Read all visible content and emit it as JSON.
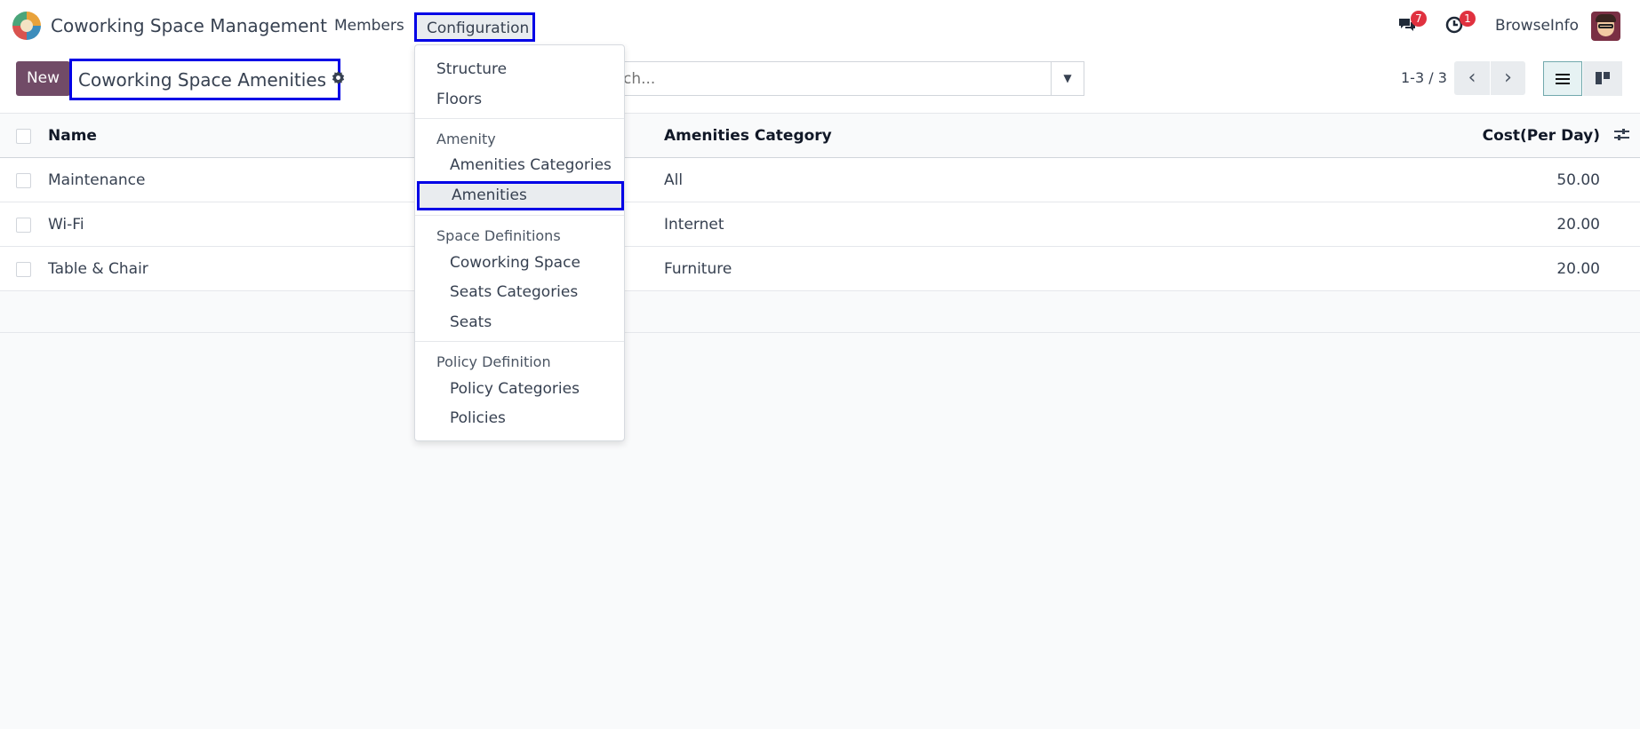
{
  "navbar": {
    "app_title": "Coworking Space Management",
    "menu": {
      "members": "Members",
      "configuration": "Configuration"
    },
    "messages_count": "7",
    "activities_count": "1",
    "company": "BrowseInfo"
  },
  "control_panel": {
    "new_label": "New",
    "breadcrumb_title": "Coworking Space Amenities",
    "search_placeholder": "ch...",
    "pager": "1-3 / 3"
  },
  "list": {
    "columns": {
      "name": "Name",
      "category": "Amenities Category",
      "cost": "Cost(Per Day)"
    },
    "rows": [
      {
        "name": "Maintenance",
        "category": "All",
        "cost": "50.00"
      },
      {
        "name": "Wi-Fi",
        "category": "Internet",
        "cost": "20.00"
      },
      {
        "name": "Table & Chair",
        "category": "Furniture",
        "cost": "20.00"
      }
    ]
  },
  "dropdown": {
    "structure": "Structure",
    "floors": "Floors",
    "amenity_header": "Amenity",
    "amenities_categories": "Amenities Categories",
    "amenities": "Amenities",
    "space_header": "Space Definitions",
    "coworking_space": "Coworking Space",
    "seats_categories": "Seats Categories",
    "seats": "Seats",
    "policy_header": "Policy Definition",
    "policy_categories": "Policy Categories",
    "policies": "Policies"
  },
  "icons": {
    "chat": "chat-icon",
    "clock": "clock-icon",
    "gear": "gear-icon",
    "search_toggle": "caret-down-icon",
    "pager_prev": "chevron-left-icon",
    "pager_next": "chevron-right-icon",
    "view_list": "list-view-icon",
    "view_kanban": "kanban-view-icon",
    "optional_columns": "sliders-icon"
  },
  "colors": {
    "primary": "#714b67",
    "highlight_border": "#0000e6",
    "badge": "#e0313f"
  }
}
